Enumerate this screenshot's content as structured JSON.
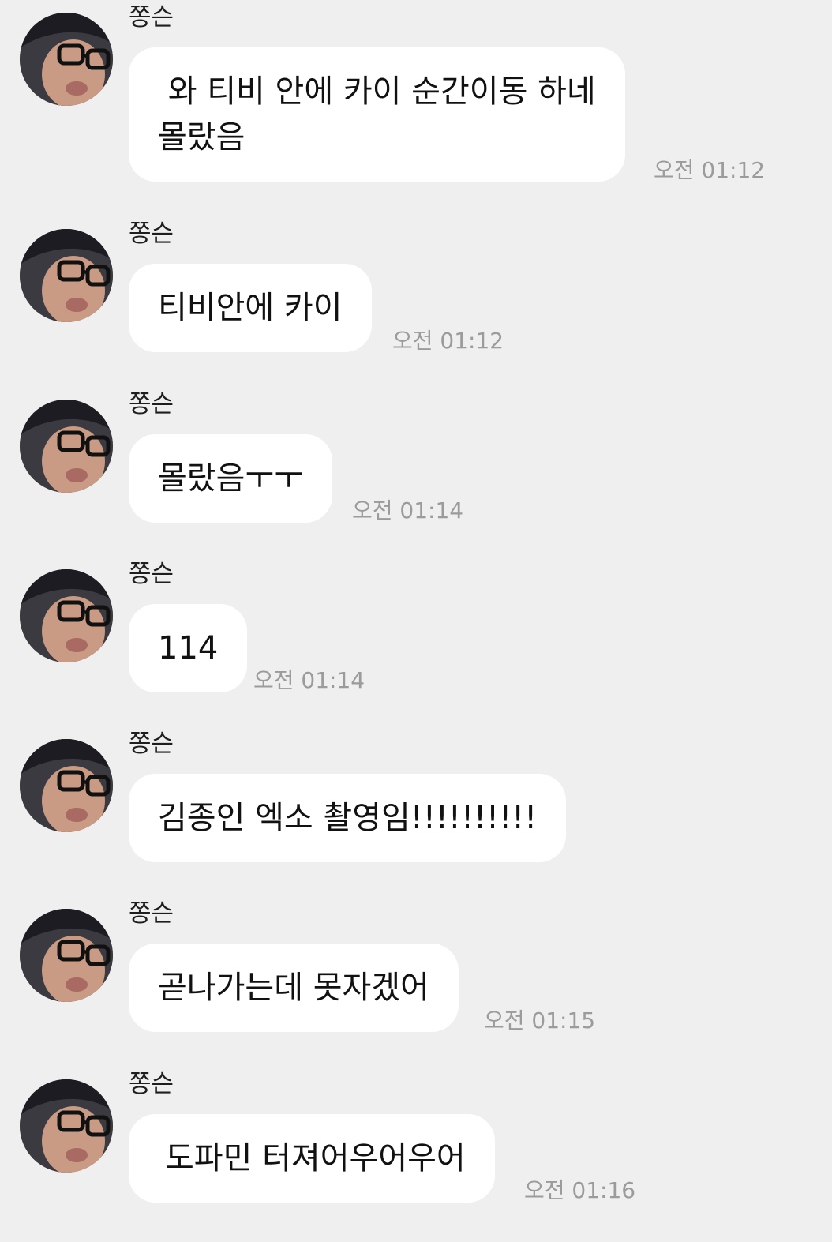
{
  "messages": [
    {
      "sender": "쫑슨",
      "text": " 와 티비 안에 카이 순간이동 하네\n몰랐음",
      "time": "오전 01:12"
    },
    {
      "sender": "쫑슨",
      "text": "티비안에 카이",
      "time": "오전 01:12"
    },
    {
      "sender": "쫑슨",
      "text": "몰랐음ㅜㅜ",
      "time": "오전 01:14"
    },
    {
      "sender": "쫑슨",
      "text": "114",
      "time": "오전 01:14"
    },
    {
      "sender": "쫑슨",
      "text": "김종인 엑소 촬영임!!!!!!!!!!",
      "time": ""
    },
    {
      "sender": "쫑슨",
      "text": "곧나가는데 못자겠어",
      "time": "오전 01:15"
    },
    {
      "sender": "쫑슨",
      "text": "도파민 터져어우어우어",
      "time": "오전 01:16"
    }
  ],
  "avatar_icon": "profile-photo"
}
